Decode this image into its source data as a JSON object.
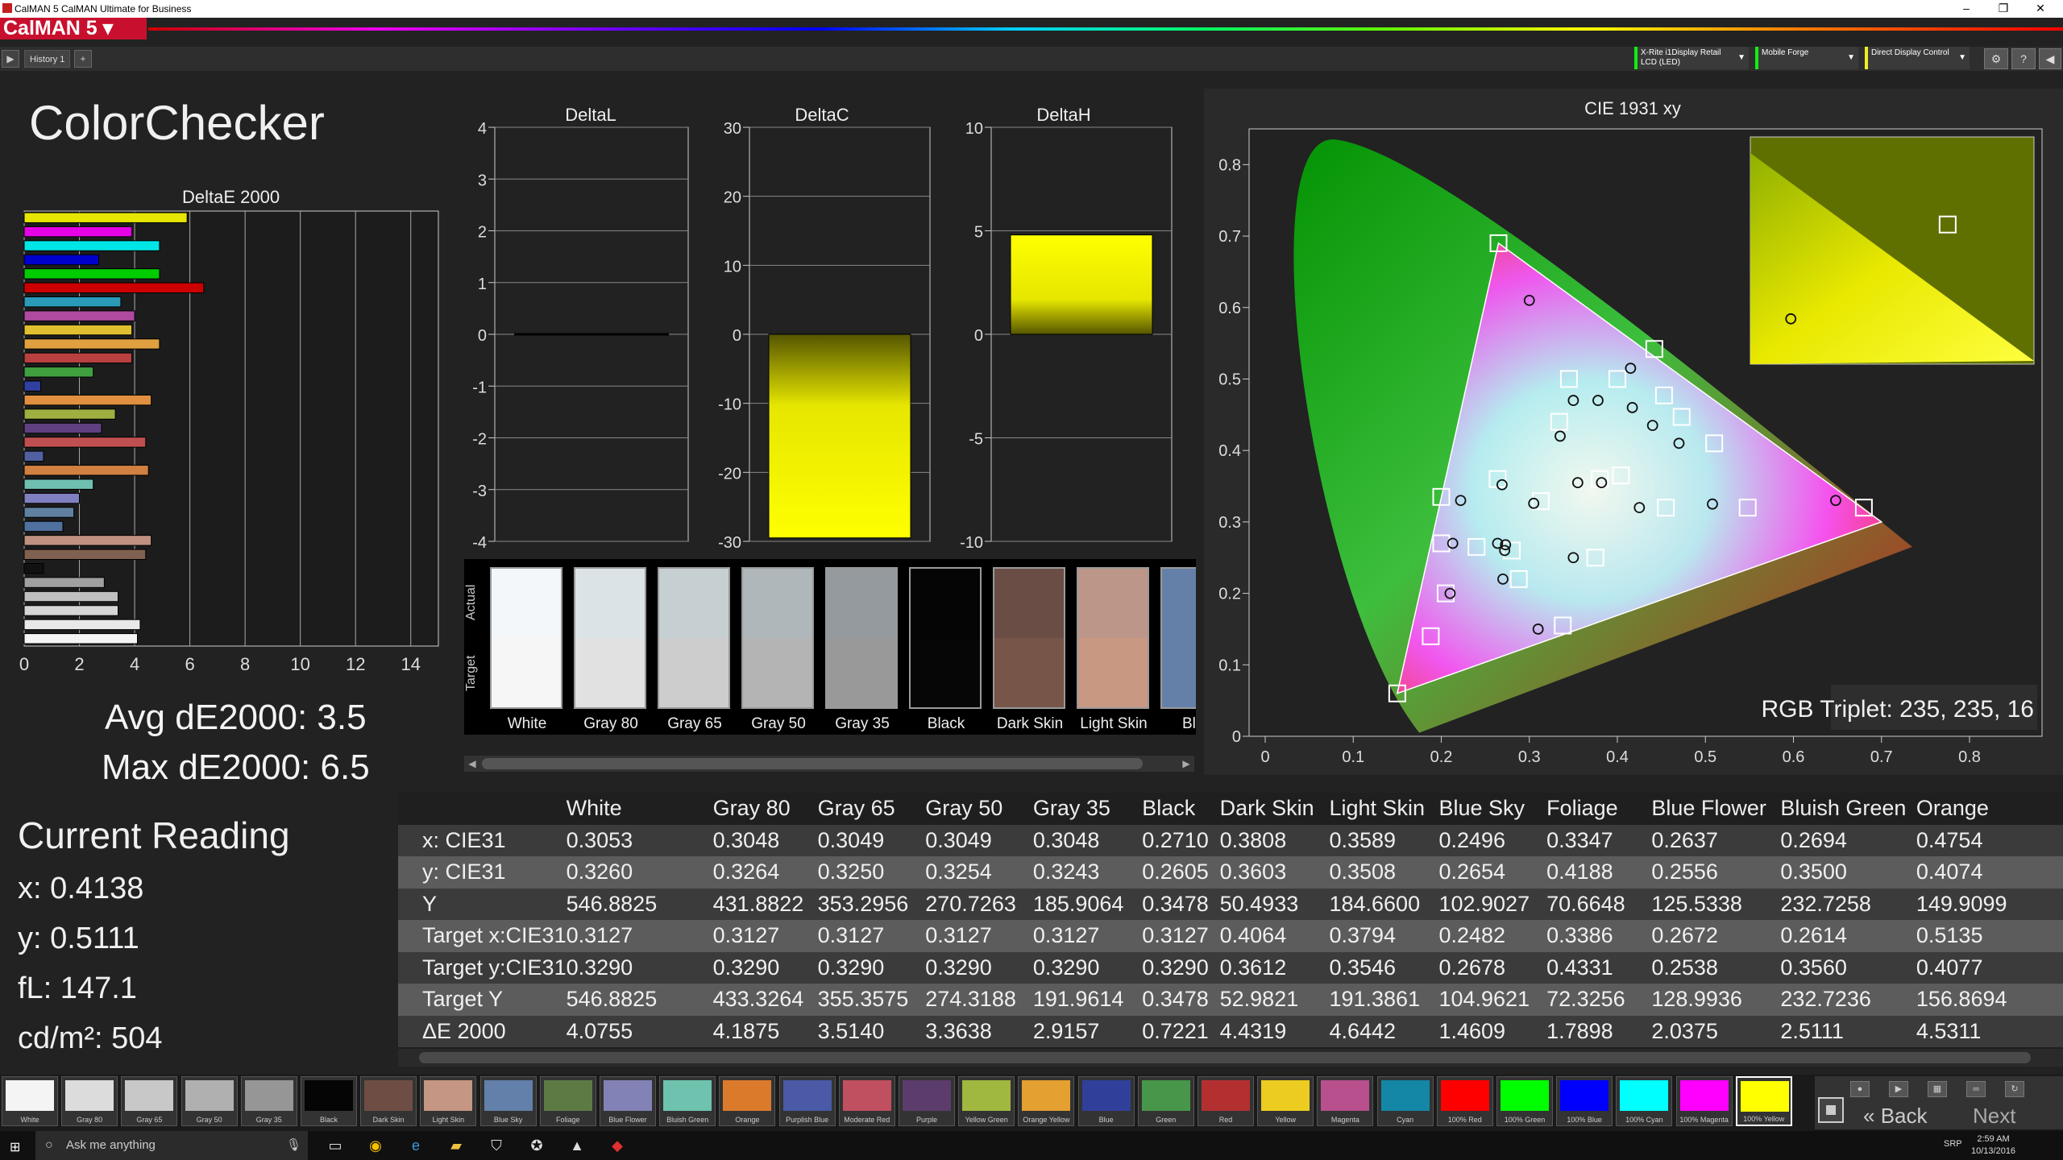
{
  "window": {
    "title": "CalMAN 5 CalMAN Ultimate for Business",
    "minimize": "–",
    "maximize": "❐",
    "close": "✕"
  },
  "logo": "CalMAN 5 ▾",
  "toolbar": {
    "history_tab": "History 1",
    "add_tab": "+"
  },
  "devices": [
    {
      "line1": "X-Rite i1Display Retail",
      "line2": "LCD (LED)"
    },
    {
      "line1": "Mobile Forge",
      "line2": ""
    },
    {
      "line1": "Direct Display Control",
      "line2": ""
    }
  ],
  "page_title": "ColorChecker",
  "deltaE": {
    "title": "DeltaE 2000",
    "ticks": [
      "0",
      "2",
      "4",
      "6",
      "8",
      "10",
      "12",
      "14"
    ],
    "xlim": [
      0,
      15
    ],
    "bars": [
      {
        "value": 5.9,
        "color": "#e6e600"
      },
      {
        "value": 3.9,
        "color": "#e600e6"
      },
      {
        "value": 4.9,
        "color": "#00e6e6"
      },
      {
        "value": 2.7,
        "color": "#0000cc"
      },
      {
        "value": 4.9,
        "color": "#00cc00"
      },
      {
        "value": 6.5,
        "color": "#cc0000"
      },
      {
        "value": 3.5,
        "color": "#2a9ab8"
      },
      {
        "value": 4.0,
        "color": "#b04aa0"
      },
      {
        "value": 3.9,
        "color": "#e0c030"
      },
      {
        "value": 4.9,
        "color": "#e0a040"
      },
      {
        "value": 3.9,
        "color": "#b84040"
      },
      {
        "value": 2.5,
        "color": "#40a040"
      },
      {
        "value": 0.6,
        "color": "#3040a0"
      },
      {
        "value": 4.6,
        "color": "#e09040"
      },
      {
        "value": 3.3,
        "color": "#a0b040"
      },
      {
        "value": 2.8,
        "color": "#604080"
      },
      {
        "value": 4.4,
        "color": "#c05050"
      },
      {
        "value": 0.7,
        "color": "#5060a0"
      },
      {
        "value": 4.5,
        "color": "#d08040"
      },
      {
        "value": 2.5,
        "color": "#70c0b0"
      },
      {
        "value": 2.0,
        "color": "#8080c0"
      },
      {
        "value": 1.8,
        "color": "#6080a0"
      },
      {
        "value": 1.4,
        "color": "#5070a0"
      },
      {
        "value": 4.6,
        "color": "#c09080"
      },
      {
        "value": 4.4,
        "color": "#806050"
      },
      {
        "value": 0.7,
        "color": "#111111"
      },
      {
        "value": 2.9,
        "color": "#a0a0a0"
      },
      {
        "value": 3.4,
        "color": "#c0c0c0"
      },
      {
        "value": 3.4,
        "color": "#d6d6d6"
      },
      {
        "value": 4.2,
        "color": "#e8e8e8"
      },
      {
        "value": 4.1,
        "color": "#f4f4f4"
      }
    ]
  },
  "avg_label": "Avg dE2000: 3.5",
  "max_label": "Max dE2000: 6.5",
  "delta_charts": [
    {
      "title": "DeltaL",
      "ticks": [
        "4",
        "3",
        "2",
        "1",
        "0",
        "-1",
        "-2",
        "-3",
        "-4"
      ],
      "ylim": [
        -4,
        4
      ],
      "value": 0.0
    },
    {
      "title": "DeltaC",
      "ticks": [
        "30",
        "20",
        "10",
        "0",
        "-10",
        "-20",
        "-30"
      ],
      "ylim": [
        -30,
        30
      ],
      "value": -29.5
    },
    {
      "title": "DeltaH",
      "ticks": [
        "10",
        "5",
        "0",
        "-5",
        "-10"
      ],
      "ylim": [
        -10,
        10
      ],
      "value": 4.8
    }
  ],
  "swatch_labels": {
    "actual": "Actual",
    "target": "Target"
  },
  "swatches": [
    {
      "name": "White",
      "actual": "#f3f7f9",
      "target": "#f6f6f6"
    },
    {
      "name": "Gray 80",
      "actual": "#dbe3e6",
      "target": "#e1e1e1"
    },
    {
      "name": "Gray 65",
      "actual": "#c6cfd2",
      "target": "#cdcdcd"
    },
    {
      "name": "Gray 50",
      "actual": "#b0b7ba",
      "target": "#b4b4b4"
    },
    {
      "name": "Gray 35",
      "actual": "#949a9d",
      "target": "#999999"
    },
    {
      "name": "Black",
      "actual": "#050505",
      "target": "#060606"
    },
    {
      "name": "Dark Skin",
      "actual": "#6a4e46",
      "target": "#775548"
    },
    {
      "name": "Light Skin",
      "actual": "#bc9789",
      "target": "#c99882"
    },
    {
      "name": "Blue",
      "actual": "#6580a8",
      "target": "#6580a8"
    }
  ],
  "cie": {
    "title": "CIE 1931 xy",
    "xticks": [
      "0",
      "0.1",
      "0.2",
      "0.3",
      "0.4",
      "0.5",
      "0.6",
      "0.7",
      "0.8"
    ],
    "yticks": [
      "0.8",
      "0.7",
      "0.6",
      "0.5",
      "0.4",
      "0.3",
      "0.2",
      "0.1",
      "0"
    ],
    "xlim": [
      0,
      0.8
    ],
    "ylim": [
      0,
      0.85
    ],
    "gamut": [
      [
        0.7,
        0.3
      ],
      [
        0.265,
        0.69
      ],
      [
        0.15,
        0.06
      ]
    ],
    "targets": [
      [
        0.265,
        0.69
      ],
      [
        0.442,
        0.542
      ],
      [
        0.4,
        0.5
      ],
      [
        0.345,
        0.5
      ],
      [
        0.334,
        0.44
      ],
      [
        0.453,
        0.477
      ],
      [
        0.473,
        0.447
      ],
      [
        0.51,
        0.41
      ],
      [
        0.38,
        0.36
      ],
      [
        0.404,
        0.365
      ],
      [
        0.264,
        0.36
      ],
      [
        0.2,
        0.335
      ],
      [
        0.313,
        0.329
      ],
      [
        0.455,
        0.32
      ],
      [
        0.548,
        0.32
      ],
      [
        0.68,
        0.32
      ],
      [
        0.375,
        0.25
      ],
      [
        0.24,
        0.265
      ],
      [
        0.2,
        0.27
      ],
      [
        0.205,
        0.2
      ],
      [
        0.288,
        0.22
      ],
      [
        0.338,
        0.155
      ],
      [
        0.188,
        0.14
      ],
      [
        0.15,
        0.06
      ],
      [
        0.28,
        0.26
      ]
    ],
    "actuals": [
      [
        0.3,
        0.61
      ],
      [
        0.415,
        0.515
      ],
      [
        0.378,
        0.47
      ],
      [
        0.35,
        0.47
      ],
      [
        0.335,
        0.42
      ],
      [
        0.417,
        0.46
      ],
      [
        0.44,
        0.435
      ],
      [
        0.47,
        0.41
      ],
      [
        0.355,
        0.355
      ],
      [
        0.382,
        0.355
      ],
      [
        0.269,
        0.352
      ],
      [
        0.222,
        0.33
      ],
      [
        0.305,
        0.326
      ],
      [
        0.425,
        0.32
      ],
      [
        0.508,
        0.325
      ],
      [
        0.648,
        0.33
      ],
      [
        0.35,
        0.25
      ],
      [
        0.272,
        0.26
      ],
      [
        0.213,
        0.27
      ],
      [
        0.21,
        0.2
      ],
      [
        0.27,
        0.22
      ],
      [
        0.31,
        0.15
      ],
      [
        0.273,
        0.268
      ],
      [
        0.264,
        0.27
      ]
    ],
    "inset_target": [
      0.44,
      0.35
    ],
    "inset_actual": [
      0.12,
      0.1
    ],
    "rgb_label": "RGB Triplet: 235, 235, 16"
  },
  "current_reading": {
    "title": "Current Reading",
    "x": "x: 0.4138",
    "y": "y: 0.5111",
    "fl": "fL: 147.1",
    "cd": "cd/m²: 504"
  },
  "table": {
    "columns": [
      "White",
      "Gray 80",
      "Gray 65",
      "Gray 50",
      "Gray 35",
      "Black",
      "Dark Skin",
      "Light Skin",
      "Blue Sky",
      "Foliage",
      "Blue Flower",
      "Bluish Green",
      "Orange"
    ],
    "rows": [
      {
        "label": "x: CIE31",
        "values": [
          "0.3053",
          "0.3048",
          "0.3049",
          "0.3049",
          "0.3048",
          "0.2710",
          "0.3808",
          "0.3589",
          "0.2496",
          "0.3347",
          "0.2637",
          "0.2694",
          "0.4754"
        ]
      },
      {
        "label": "y: CIE31",
        "values": [
          "0.3260",
          "0.3264",
          "0.3250",
          "0.3254",
          "0.3243",
          "0.2605",
          "0.3603",
          "0.3508",
          "0.2654",
          "0.4188",
          "0.2556",
          "0.3500",
          "0.4074"
        ]
      },
      {
        "label": "Y",
        "values": [
          "546.8825",
          "431.8822",
          "353.2956",
          "270.7263",
          "185.9064",
          "0.3478",
          "50.4933",
          "184.6600",
          "102.9027",
          "70.6648",
          "125.5338",
          "232.7258",
          "149.9099"
        ]
      },
      {
        "label": "Target x:CIE31",
        "values": [
          "0.3127",
          "0.3127",
          "0.3127",
          "0.3127",
          "0.3127",
          "0.3127",
          "0.4064",
          "0.3794",
          "0.2482",
          "0.3386",
          "0.2672",
          "0.2614",
          "0.5135"
        ]
      },
      {
        "label": "Target y:CIE31",
        "values": [
          "0.3290",
          "0.3290",
          "0.3290",
          "0.3290",
          "0.3290",
          "0.3290",
          "0.3612",
          "0.3546",
          "0.2678",
          "0.4331",
          "0.2538",
          "0.3560",
          "0.4077"
        ]
      },
      {
        "label": "Target Y",
        "values": [
          "546.8825",
          "433.3264",
          "355.3575",
          "274.3188",
          "191.9614",
          "0.3478",
          "52.9821",
          "191.3861",
          "104.9621",
          "72.3256",
          "128.9936",
          "232.7236",
          "156.8694"
        ]
      },
      {
        "label": "ΔE 2000",
        "values": [
          "4.0755",
          "4.1875",
          "3.5140",
          "3.3638",
          "2.9157",
          "0.7221",
          "4.4319",
          "4.6442",
          "1.4609",
          "1.7898",
          "2.0375",
          "2.5111",
          "4.5311"
        ]
      }
    ]
  },
  "strip": [
    {
      "name": "White",
      "color": "#f4f4f4"
    },
    {
      "name": "Gray 80",
      "color": "#dcdcdc"
    },
    {
      "name": "Gray 65",
      "color": "#c8c8c8"
    },
    {
      "name": "Gray 50",
      "color": "#b0b0b0"
    },
    {
      "name": "Gray 35",
      "color": "#969696"
    },
    {
      "name": "Black",
      "color": "#050505"
    },
    {
      "name": "Dark Skin",
      "color": "#6e4e44"
    },
    {
      "name": "Light Skin",
      "color": "#c49683"
    },
    {
      "name": "Blue Sky",
      "color": "#6380aa"
    },
    {
      "name": "Foliage",
      "color": "#5e7a44"
    },
    {
      "name": "Blue Flower",
      "color": "#8282b6"
    },
    {
      "name": "Bluish Green",
      "color": "#6ec2ae"
    },
    {
      "name": "Orange",
      "color": "#dc7a2c"
    },
    {
      "name": "Purplish Blue",
      "color": "#4a5aa6"
    },
    {
      "name": "Moderate Red",
      "color": "#c05060"
    },
    {
      "name": "Purple",
      "color": "#5c3c6c"
    },
    {
      "name": "Yellow Green",
      "color": "#a0b840"
    },
    {
      "name": "Orange Yellow",
      "color": "#e4a030"
    },
    {
      "name": "Blue",
      "color": "#30409a"
    },
    {
      "name": "Green",
      "color": "#48964a"
    },
    {
      "name": "Red",
      "color": "#b43030"
    },
    {
      "name": "Yellow",
      "color": "#eccc20"
    },
    {
      "name": "Magenta",
      "color": "#b8508e"
    },
    {
      "name": "Cyan",
      "color": "#1486a6"
    },
    {
      "name": "100% Red",
      "color": "#ff0000"
    },
    {
      "name": "100% Green",
      "color": "#00ff00"
    },
    {
      "name": "100% Blue",
      "color": "#0000ff"
    },
    {
      "name": "100% Cyan",
      "color": "#00ffff"
    },
    {
      "name": "100% Magenta",
      "color": "#ff00ff"
    },
    {
      "name": "100% Yellow",
      "color": "#ffff00"
    }
  ],
  "nav": {
    "back": "Back",
    "next": "Next"
  },
  "taskbar": {
    "search_placeholder": "Ask me anything",
    "time": "2:59 AM",
    "date": "10/13/2016",
    "lang": "SRP"
  }
}
